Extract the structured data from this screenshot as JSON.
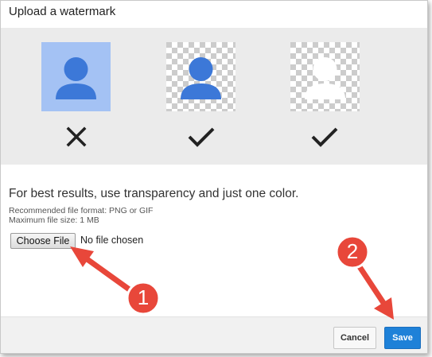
{
  "dialog": {
    "title": "Upload a watermark"
  },
  "examples": [
    {
      "style": "solid-blue-background",
      "verdict": "x-icon"
    },
    {
      "style": "transparent-blue-figure",
      "verdict": "check-icon"
    },
    {
      "style": "transparent-white-figure",
      "verdict": "check-icon"
    }
  ],
  "tips": {
    "main": "For best results, use transparency and just one color.",
    "format": "Recommended file format: PNG or GIF",
    "size": "Maximum file size: 1 MB"
  },
  "file_input": {
    "button_label": "Choose File",
    "status": "No file chosen"
  },
  "footer": {
    "cancel_label": "Cancel",
    "save_label": "Save"
  },
  "annotations": {
    "step1": "1",
    "step2": "2",
    "color": "#e8473a"
  },
  "colors": {
    "figure_blue": "#3c78d8",
    "light_blue_bg": "#a4c2f4",
    "save_blue": "#1e81d8"
  }
}
